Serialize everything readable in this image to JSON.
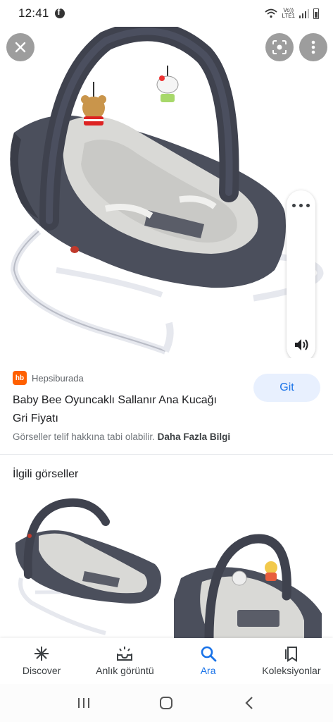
{
  "status": {
    "time": "12:41",
    "network_top": "Vo))",
    "network_bottom": "LTE1"
  },
  "viewer": {
    "close_icon": "close-icon",
    "lens_icon": "lens-icon",
    "more_icon": "more-vert-icon",
    "speaker_icon": "volume-icon"
  },
  "result": {
    "source": {
      "logo_text": "hb",
      "name": "Hepsiburada",
      "logo_color": "#ff6000"
    },
    "title": "Baby Bee Oyuncaklı Sallanır Ana Kucağı Gri Fiyatı",
    "visit_label": "Git",
    "copyright_text": "Görseller telif hakkına tabi olabilir.",
    "more_info_label": "Daha Fazla Bilgi"
  },
  "related": {
    "title": "İlgili görseller"
  },
  "bottom_nav": [
    {
      "label": "Discover",
      "icon": "asterisk-icon"
    },
    {
      "label": "Anlık görüntü",
      "icon": "inbox-icon"
    },
    {
      "label": "Ara",
      "icon": "search-icon",
      "active": true
    },
    {
      "label": "Koleksiyonlar",
      "icon": "collections-icon"
    }
  ],
  "colors": {
    "accent": "#1a73e8",
    "visit_bg": "#e8f0fe",
    "bouncer_gray": "#4b4f5c",
    "cushion": "#d9d9d6"
  }
}
